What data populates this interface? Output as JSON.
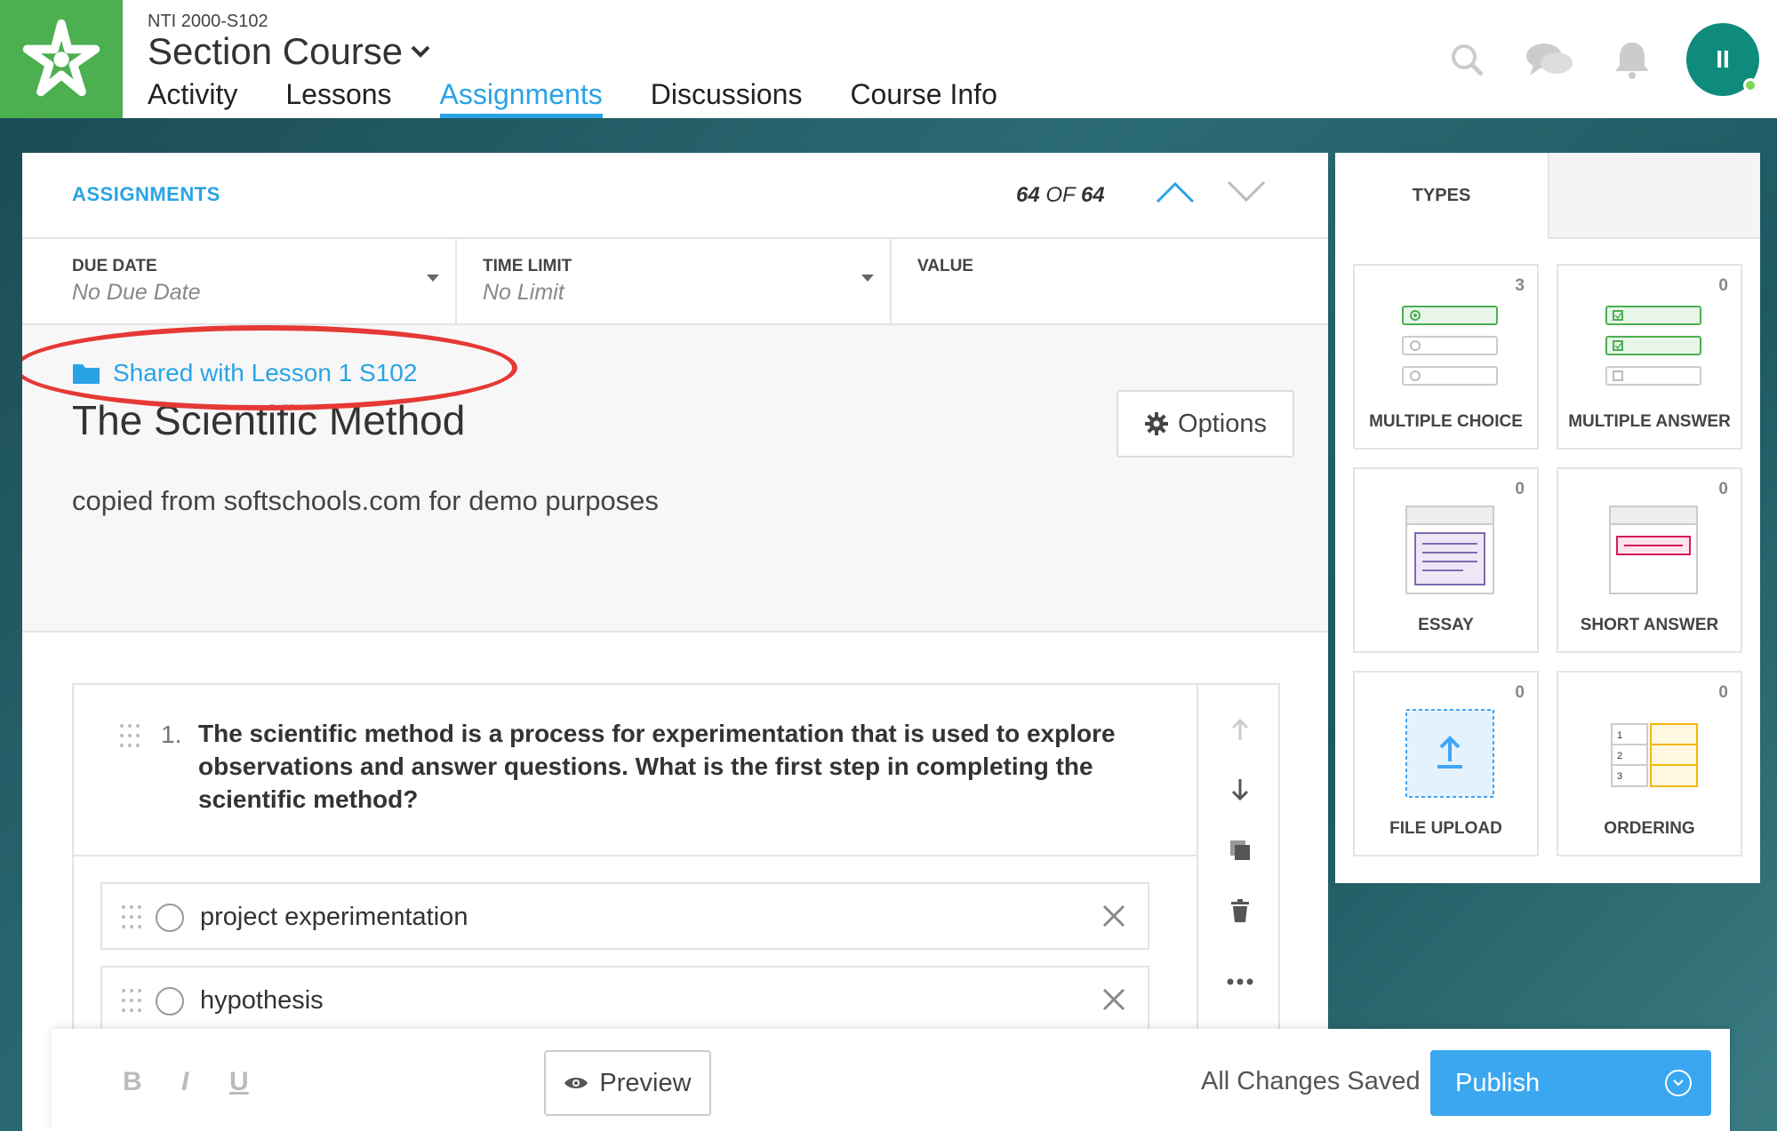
{
  "header": {
    "course_code": "NTI 2000-S102",
    "course_title": "Section Course",
    "tabs": [
      {
        "label": "Activity"
      },
      {
        "label": "Lessons"
      },
      {
        "label": "Assignments"
      },
      {
        "label": "Discussions"
      },
      {
        "label": "Course Info"
      }
    ],
    "active_tab": "Assignments",
    "avatar_initials": "II",
    "brand_color": "#4caf50",
    "accent_color": "#2aa3e5"
  },
  "panel": {
    "label": "ASSIGNMENTS",
    "counter_current": "64",
    "counter_of": "OF",
    "counter_total": "64"
  },
  "meta": {
    "due_date_label": "DUE DATE",
    "due_date_value": "No Due Date",
    "time_limit_label": "TIME LIMIT",
    "time_limit_value": "No Limit",
    "value_label": "VALUE"
  },
  "assignment": {
    "shared_text": "Shared with Lesson 1 S102",
    "title": "The Scientific Method",
    "description": "copied from softschools.com for demo purposes",
    "options_label": "Options"
  },
  "question": {
    "number": "1.",
    "text": "The scientific method is a process for experimentation that is used to explore observations and answer questions. What is the first step in completing the scientific method?",
    "answers": [
      {
        "text": "project experimentation"
      },
      {
        "text": "hypothesis"
      }
    ]
  },
  "bottom": {
    "bold": "B",
    "italic": "I",
    "underline": "U",
    "preview_label": "Preview",
    "saved_text": "All Changes Saved",
    "publish_label": "Publish"
  },
  "types": {
    "tab_label": "TYPES",
    "cards": [
      {
        "label": "MULTIPLE CHOICE",
        "count": "3"
      },
      {
        "label": "MULTIPLE ANSWER",
        "count": "0"
      },
      {
        "label": "ESSAY",
        "count": "0"
      },
      {
        "label": "SHORT ANSWER",
        "count": "0"
      },
      {
        "label": "FILE UPLOAD",
        "count": "0"
      },
      {
        "label": "ORDERING",
        "count": "0"
      }
    ]
  }
}
